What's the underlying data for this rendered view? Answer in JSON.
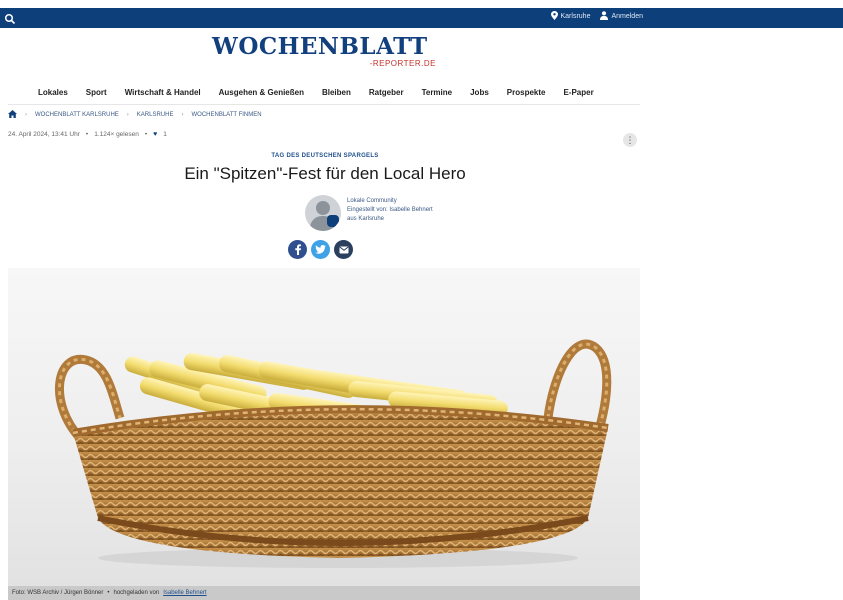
{
  "topbar": {
    "location_label": "Karlsruhe",
    "login_label": "Anmelden"
  },
  "logo": {
    "main": "WOCHENBLATT",
    "sub": "-REPORTER.DE"
  },
  "nav": {
    "items": [
      "Lokales",
      "Sport",
      "Wirtschaft & Handel",
      "Ausgehen & Genießen",
      "Bleiben",
      "Ratgeber",
      "Termine",
      "Jobs",
      "Prospekte",
      "E-Paper"
    ]
  },
  "breadcrumb": {
    "items": [
      "WOCHENBLATT KARLSRUHE",
      "KARLSRUHE",
      "WOCHENBLATT FINMEN"
    ]
  },
  "meta": {
    "date": "24. April 2024, 13:41 Uhr",
    "reads": "1.124× gelesen",
    "likes": "1"
  },
  "article": {
    "kicker": "TAG DES DEUTSCHEN SPARGELS",
    "headline": "Ein \"Spitzen\"-Fest für den Local Hero",
    "author_line1": "Lokale Community",
    "author_line2": "Eingestellt von: Isabelle Behnert",
    "author_line3": "aus Karlsruhe"
  },
  "caption": {
    "text": "Foto: WSB Archiv / Jürgen Bönner",
    "uploaded_label": "hochgeladen von",
    "uploader": "Isabelle Behnert"
  },
  "icons": {
    "search": "search-icon",
    "location": "location-pin-icon",
    "user": "user-icon",
    "home": "home-icon",
    "heart": "heart-icon",
    "kebab": "more-vertical-icon",
    "facebook": "facebook-icon",
    "twitter": "twitter-icon",
    "email": "email-icon"
  },
  "colors": {
    "brand": "#0d3f7a",
    "accent": "#c8312b",
    "link": "#1f4f8b"
  }
}
